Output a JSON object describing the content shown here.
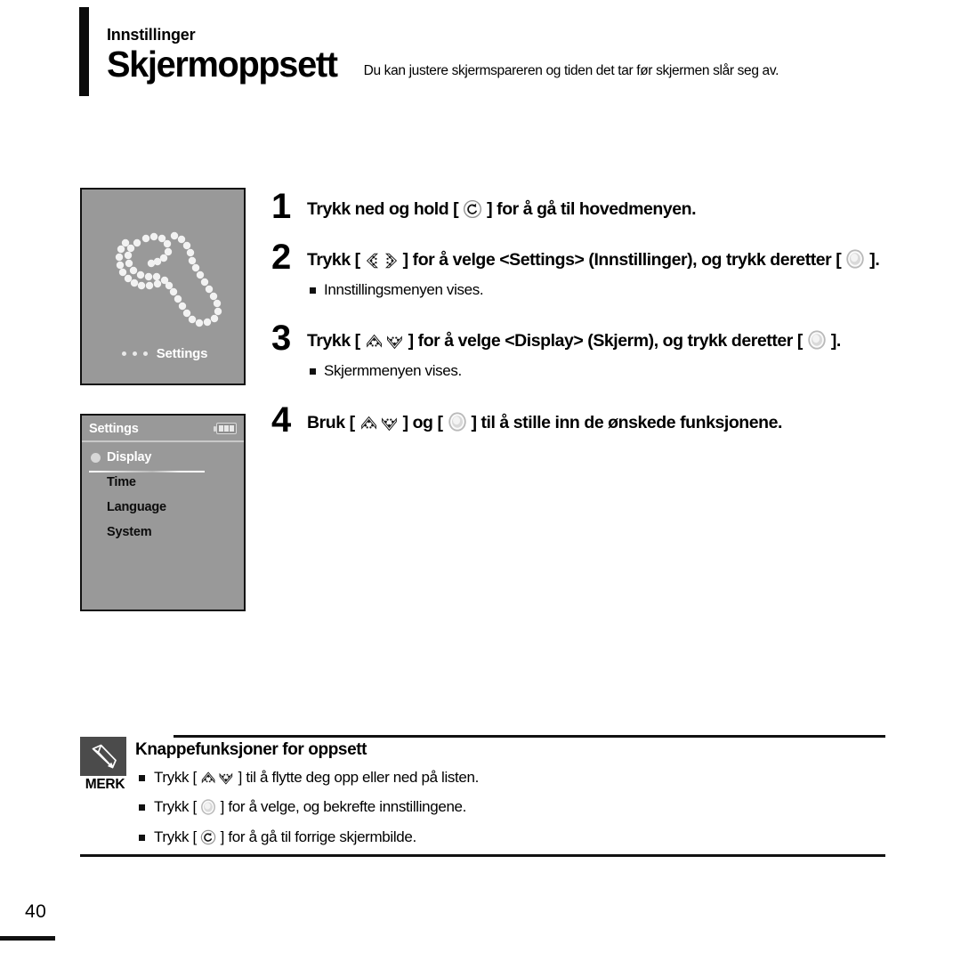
{
  "header": {
    "eyebrow": "Innstillinger",
    "title": "Skjermoppsett",
    "subtitle": "Du kan justere skjermspareren og tiden det tar før skjermen slår seg av."
  },
  "device_screens": [
    {
      "name": "settings-splash",
      "icon": "wrench-dotted-icon",
      "label": "Settings",
      "dots": 3
    },
    {
      "name": "settings-menu",
      "title": "Settings",
      "battery_icon": "battery-icon",
      "battery_bars": 3,
      "items": [
        {
          "label": "Display",
          "selected": true
        },
        {
          "label": "Time",
          "selected": false
        },
        {
          "label": "Language",
          "selected": false
        },
        {
          "label": "System",
          "selected": false
        }
      ]
    }
  ],
  "steps": [
    {
      "num": "1",
      "text_parts": [
        "Trykk ned og hold [ ",
        " ] for å gå til hovedmenyen."
      ],
      "icons": [
        "return-button-icon"
      ],
      "note": null
    },
    {
      "num": "2",
      "text_parts": [
        "Trykk [ ",
        " ] for å velge <Settings> (Innstillinger), og trykk deretter [ ",
        " ]."
      ],
      "icons": [
        "left-right-button-icon",
        "select-button-icon"
      ],
      "note": "Innstillingsmenyen vises."
    },
    {
      "num": "3",
      "text_parts": [
        "Trykk [ ",
        " ] for å velge <Display> (Skjerm), og trykk deretter [ ",
        " ]."
      ],
      "icons": [
        "up-down-button-icon",
        "select-button-icon"
      ],
      "note": "Skjermmenyen vises."
    },
    {
      "num": "4",
      "text_parts": [
        "Bruk [ ",
        " ] og [ ",
        " ] til å stille inn de ønskede funksjonene."
      ],
      "icons": [
        "up-down-button-icon",
        "select-button-icon"
      ],
      "note": null
    }
  ],
  "note_box": {
    "badge_label": "MERK",
    "badge_icon": "pencil-icon",
    "title": "Knappefunksjoner for oppsett",
    "lines": [
      {
        "pre": "Trykk [ ",
        "post": " ] til å flytte deg opp eller ned på listen.",
        "icon": "up-down-button-icon"
      },
      {
        "pre": "Trykk [ ",
        "post": " ] for å velge, og bekrefte innstillingene.",
        "icon": "select-button-icon"
      },
      {
        "pre": "Trykk [ ",
        "post": " ] for å gå til forrige skjermbilde.",
        "icon": "return-button-icon"
      }
    ]
  },
  "footer": {
    "page_number": "40"
  },
  "colors": {
    "screen_bg": "#999999",
    "screen_border": "#111111",
    "badge_bg": "#4b4b4b",
    "ink": "#000000"
  }
}
